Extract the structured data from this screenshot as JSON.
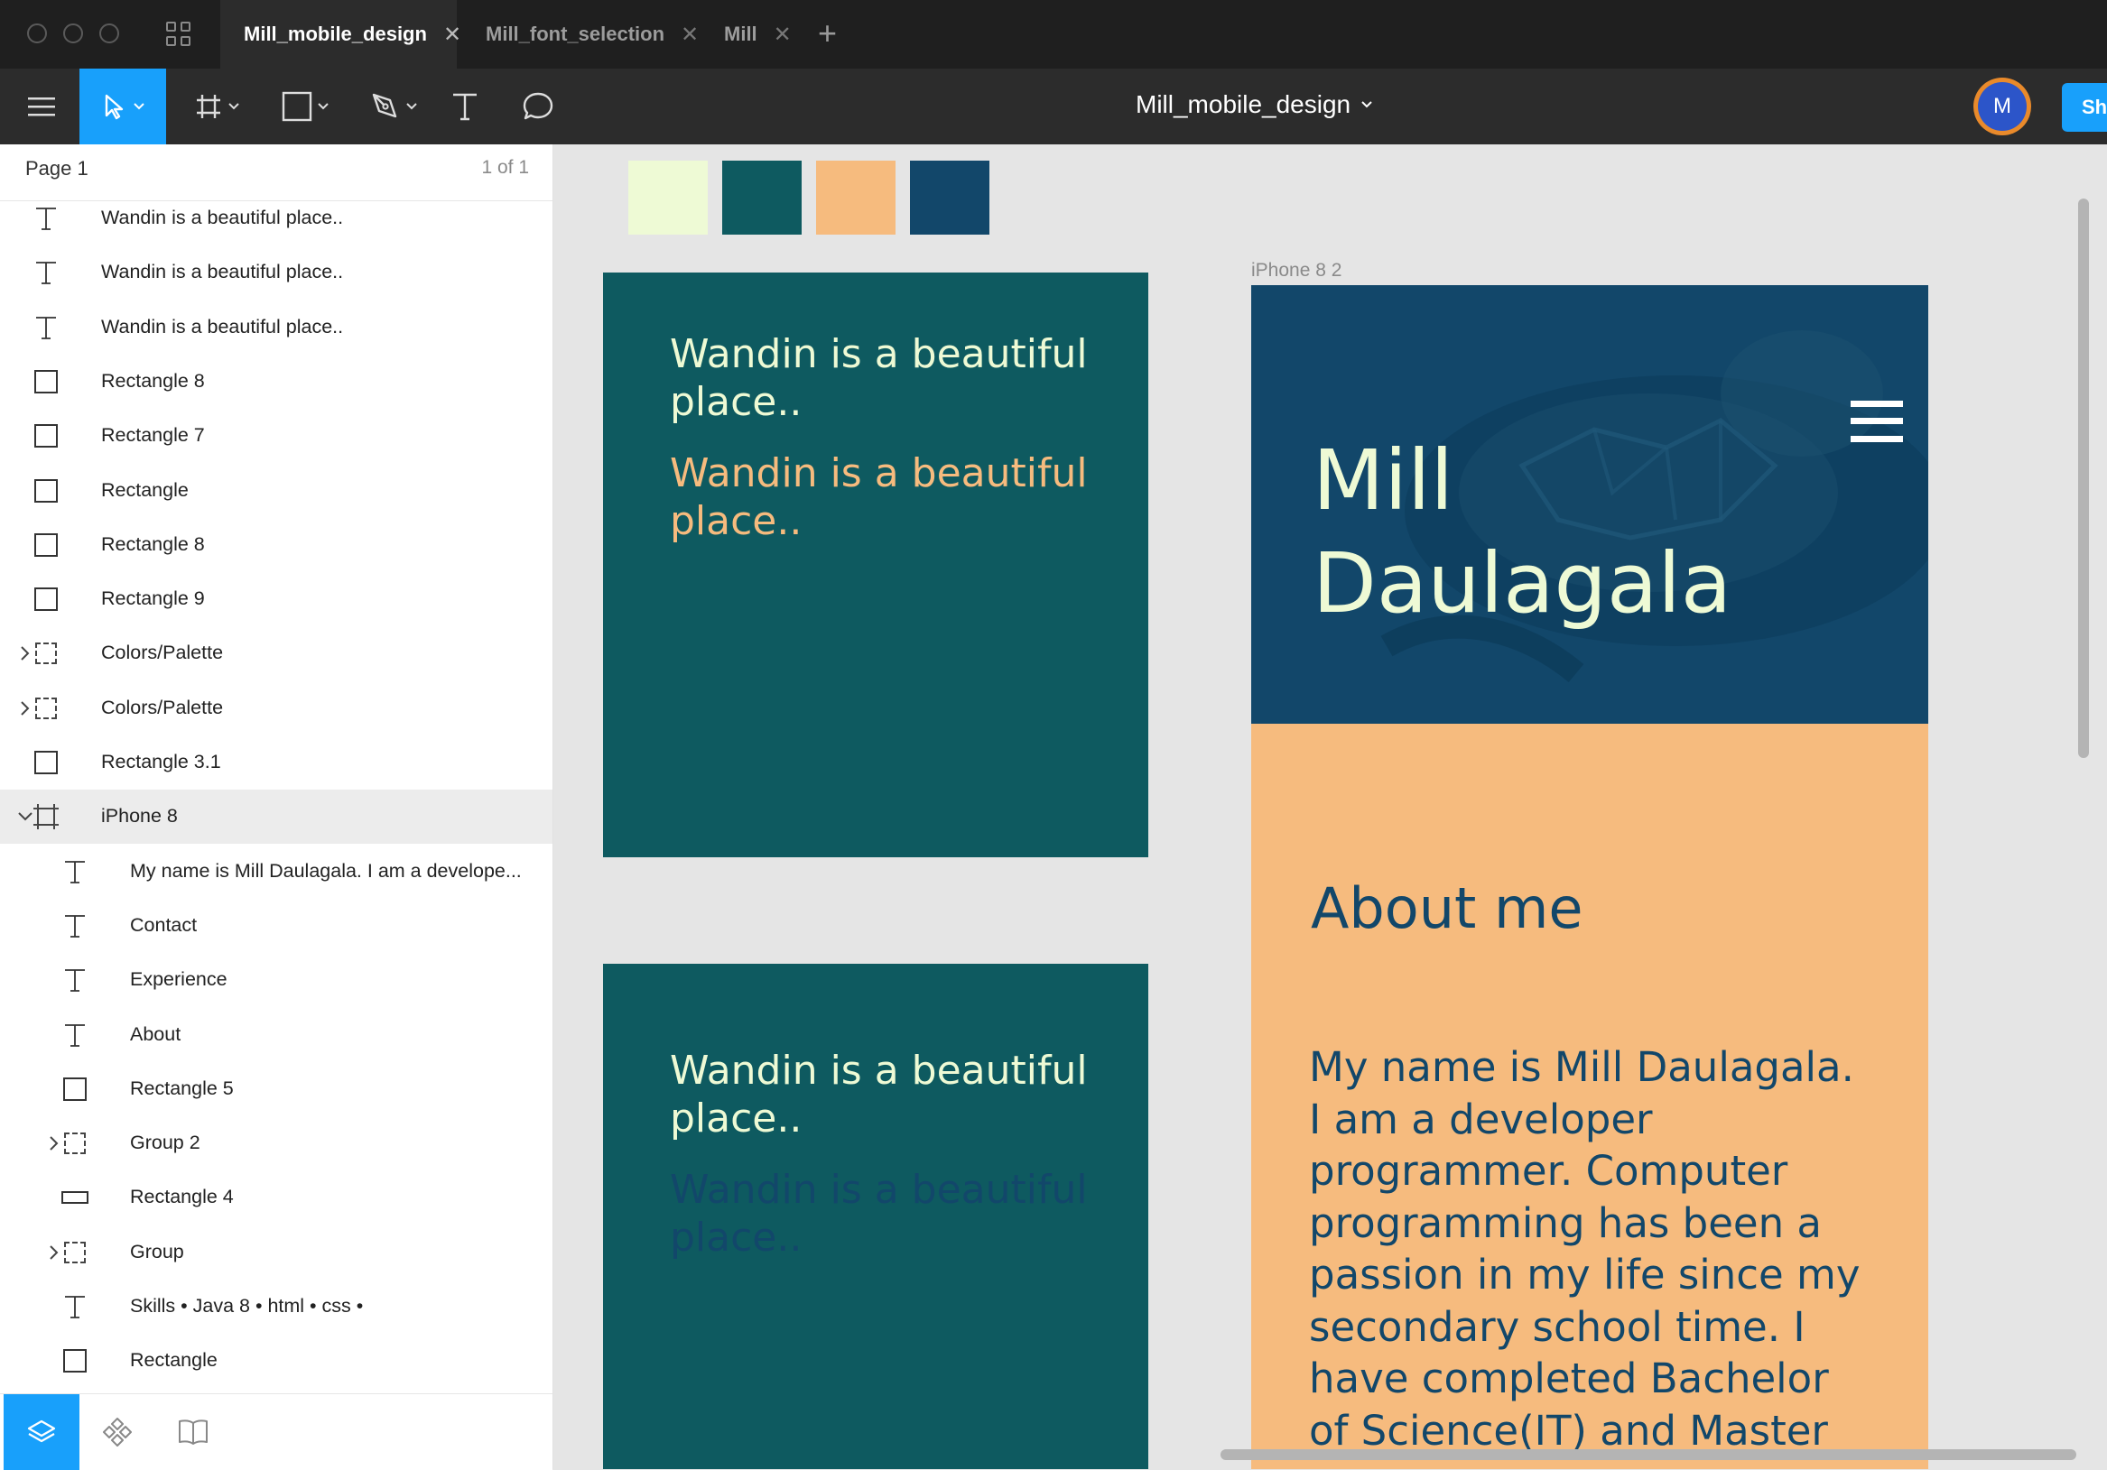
{
  "tabs": [
    {
      "label": "Mill_mobile_design",
      "active": true
    },
    {
      "label": "Mill_font_selection",
      "active": false
    },
    {
      "label": "Mill",
      "active": false
    }
  ],
  "toolbar": {
    "document_title": "Mill_mobile_design",
    "avatar_initial": "M",
    "share_label": "Sh"
  },
  "layers_panel": {
    "page_name": "Page 1",
    "page_count": "1 of 1",
    "layers": [
      {
        "label": "Wandin is a beautiful place..",
        "icon": "text-icon"
      },
      {
        "label": "Wandin is a beautiful place..",
        "icon": "text-icon"
      },
      {
        "label": "Wandin is a beautiful place..",
        "icon": "text-icon"
      },
      {
        "label": "Rectangle 8",
        "icon": "rectangle-icon"
      },
      {
        "label": "Rectangle 7",
        "icon": "rectangle-icon"
      },
      {
        "label": "Rectangle",
        "icon": "rectangle-icon"
      },
      {
        "label": "Rectangle 8",
        "icon": "rectangle-icon"
      },
      {
        "label": "Rectangle 9",
        "icon": "rectangle-icon"
      },
      {
        "label": "Colors/Palette",
        "icon": "group-icon",
        "collapsed": true
      },
      {
        "label": "Colors/Palette",
        "icon": "group-icon",
        "collapsed": true
      },
      {
        "label": "Rectangle 3.1",
        "icon": "rectangle-icon"
      },
      {
        "label": "iPhone 8",
        "icon": "frame-icon",
        "expanded": true,
        "selected": true
      },
      {
        "label": "My name is Mill Daulagala. I am a develope...",
        "icon": "text-icon",
        "child": true
      },
      {
        "label": "Contact",
        "icon": "text-icon",
        "child": true
      },
      {
        "label": "Experience",
        "icon": "text-icon",
        "child": true
      },
      {
        "label": "About",
        "icon": "text-icon",
        "child": true
      },
      {
        "label": "Rectangle 5",
        "icon": "rectangle-icon",
        "child": true
      },
      {
        "label": "Group 2",
        "icon": "group-icon",
        "child": true,
        "collapsed": true
      },
      {
        "label": "Rectangle 4",
        "icon": "wide-rectangle-icon",
        "child": true
      },
      {
        "label": "Group",
        "icon": "group-icon",
        "child": true,
        "collapsed": true
      },
      {
        "label": "Skills • Java 8 • html • css •",
        "icon": "text-icon",
        "child": true
      },
      {
        "label": "Rectangle",
        "icon": "rectangle-icon",
        "child": true
      }
    ],
    "footer_tabs": [
      "layers-icon",
      "components-icon",
      "library-icon"
    ]
  },
  "canvas": {
    "swatches": [
      "#eefad5",
      "#0e5a60",
      "#f6bb7e",
      "#12476a"
    ],
    "frame1": {
      "text1": "Wandin is a beautiful place..",
      "text2": "Wandin is a beautiful place..",
      "bg": "#0e5a60",
      "text1_color": "#eefad5",
      "text2_color": "#f6bb7e"
    },
    "frame2": {
      "text1": "Wandin is a beautiful place..",
      "text2": "Wandin is a beautiful place..",
      "bg": "#0e5a60",
      "text1_color": "#eefad5",
      "text2_color": "#12476a"
    },
    "phone": {
      "label": "iPhone 8 2",
      "hero_name": "Mill Daulagala",
      "about_title": "About me",
      "about_body": "My name is Mill Daulagala. I am a developer programmer. Computer programming has been a passion in my life since my secondary school time. I have completed Bachelor of Science(IT) and Master"
    }
  },
  "colors": {
    "accent": "#18a0fb",
    "titlebar": "#1f1f1f",
    "toolbar": "#2c2c2c",
    "canvas_bg": "#e5e5e5"
  }
}
